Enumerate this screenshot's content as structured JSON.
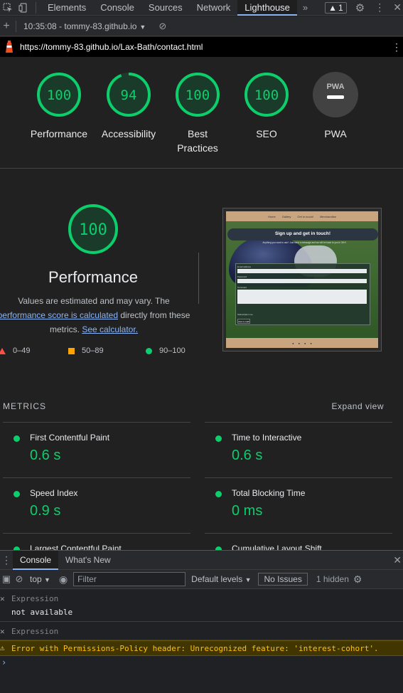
{
  "devtools": {
    "tabs": [
      "Elements",
      "Console",
      "Sources",
      "Network",
      "Lighthouse"
    ],
    "active_tab": "Lighthouse",
    "more_tabs": "»",
    "warning_count": "1"
  },
  "report_toolbar": {
    "report_label": "10:35:08 - tommy-83.github.io"
  },
  "url_bar": {
    "url": "https://tommy-83.github.io/Lax-Bath/contact.html"
  },
  "gauges": [
    {
      "score": "100",
      "label": "Performance"
    },
    {
      "score": "94",
      "label": "Accessibility",
      "fraction": 0.94
    },
    {
      "score": "100",
      "label": "Best Practices",
      "label_lines": [
        "Best",
        "Practices"
      ]
    },
    {
      "score": "100",
      "label": "SEO"
    },
    {
      "score": "",
      "label": "PWA",
      "badge": "PWA"
    }
  ],
  "performance": {
    "score": "100",
    "title": "Performance",
    "desc_prefix": "Values are estimated and may vary. The",
    "link1": "performance score is calculated",
    "desc_mid": "directly from these metrics.",
    "link2": "See calculator."
  },
  "legend": [
    {
      "range": "0–49",
      "color": "#ff4e42"
    },
    {
      "range": "50–89",
      "color": "#ffa400"
    },
    {
      "range": "90–100",
      "color": "#0cce6b"
    }
  ],
  "screenshot": {
    "nav_items": [
      "Home",
      "Gallery",
      "Get in touch!",
      "Merchandise"
    ],
    "banner": "Sign up and get in touch!",
    "subtitle": "Anything you want to ask? Just send a message and we will be back to you in 24H!",
    "field_labels": [
      "Email address",
      "Password",
      "Comment"
    ],
    "checkbox_label": "Subscription me",
    "button": "Ask to mail!"
  },
  "metrics": {
    "heading": "METRICS",
    "expand": "Expand view",
    "items": [
      {
        "name": "First Contentful Paint",
        "value": "0.6 s"
      },
      {
        "name": "Time to Interactive",
        "value": "0.6 s"
      },
      {
        "name": "Speed Index",
        "value": "0.9 s"
      },
      {
        "name": "Total Blocking Time",
        "value": "0 ms"
      },
      {
        "name": "Largest Contentful Paint",
        "value": ""
      },
      {
        "name": "Cumulative Layout Shift",
        "value": ""
      }
    ]
  },
  "drawer": {
    "tabs": [
      "Console",
      "What's New"
    ],
    "active_tab": "Console",
    "context": "top",
    "filter_placeholder": "Filter",
    "levels": "Default levels",
    "issues": "No Issues",
    "hidden": "1 hidden",
    "expressions": [
      {
        "placeholder": "Expression",
        "result": "not available"
      },
      {
        "placeholder": "Expression",
        "result": ""
      }
    ],
    "warning": "Error with Permissions-Policy header: Unrecognized feature: 'interest-cohort'."
  },
  "colors": {
    "pass": "#0cce6b",
    "average": "#ffa400",
    "fail": "#ff4e42",
    "link": "#8ab4f8"
  }
}
